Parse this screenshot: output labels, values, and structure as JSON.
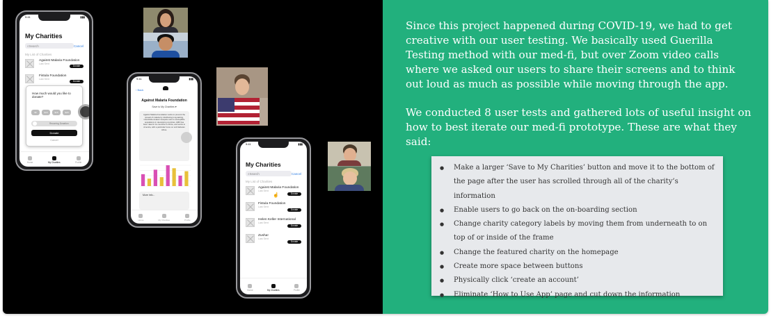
{
  "colors": {
    "left_background": "#000000",
    "right_background": "#22b07d",
    "card_background": "#e7e9ec",
    "text_light": "#ffffff"
  },
  "phone1": {
    "status_time": "9:41",
    "title": "My Charities",
    "search_placeholder": "Search",
    "cancel": "Cancel",
    "list_heading": "My List of Charities",
    "rows": [
      {
        "name": "Against Malaria Foundation",
        "sub": "Last Sent",
        "action": "Donate"
      },
      {
        "name": "Fistula Foundation",
        "sub": "Last Sent",
        "action": "Donate"
      }
    ],
    "modal": {
      "question": "How much would you like to donate?",
      "amounts": [
        "$5",
        "$10",
        "$15",
        "$20"
      ],
      "toggle_label": "Recurring Donation",
      "donate": "Donate",
      "cancel": "Cancel"
    },
    "tabs": [
      "Home",
      "My Charities",
      "Profile"
    ]
  },
  "phone2": {
    "status_time": "9:41",
    "back": "Back",
    "title": "Against Malaria Foundation",
    "save": "Save to My Charities ♥",
    "description": "Against Malaria Foundation works to prevent the spread of malaria by distributing long-lasting, insecticide-treated mosquito nets to susceptible populations in developing countries. AMF has been rated in its countries in Africa, and works to America, with a particular focus on sub-Saharan Africa.",
    "more": "More info...",
    "chart_bars": [
      40,
      25,
      55,
      30,
      70,
      60,
      35,
      50
    ],
    "tabs": [
      "Home",
      "My Charities",
      "Profile"
    ]
  },
  "phone3": {
    "status_time": "9:41",
    "title": "My Charities",
    "search_placeholder": "Search",
    "cancel": "Cancel",
    "list_heading": "My List of Charities",
    "rows": [
      {
        "name": "Against Malaria Foundation",
        "sub": "Last Sent",
        "action": "Donate"
      },
      {
        "name": "Fistula Foundation",
        "sub": "Last Sent",
        "action": "Donate"
      },
      {
        "name": "Helen Keller International",
        "sub": "Last Sent",
        "action": "Donate"
      },
      {
        "name": "Zusha!",
        "sub": "Last Sent",
        "action": "Donate"
      }
    ],
    "tabs": [
      "Home",
      "My Charities",
      "Profile"
    ]
  },
  "text": {
    "paragraph1": "Since this project happened during COVID-19, we had to get creative with our user testing. We basically used Guerilla Testing method with our med-fi, but over Zoom video calls where we asked our users to share their screens and to think out loud as much as possible while moving through the app.",
    "paragraph2": "We conducted 8 user tests and gathered lots of useful insight on how to best iterate our med-fi prototype. These are what they said:"
  },
  "feedback": [
    "Make a larger ‘Save to My Charities’ button and move it to the bottom of the page after the user has scrolled through all of the charity’s information",
    "Enable users to go back on the on-boarding section",
    "Change charity category labels by moving them from underneath to on top of or inside of the frame",
    "Change the featured charity on the homepage",
    "Create more space between buttons",
    "Physically click ‘create an account’",
    "Eliminate ‘How to Use App’ page and cut down the information"
  ]
}
